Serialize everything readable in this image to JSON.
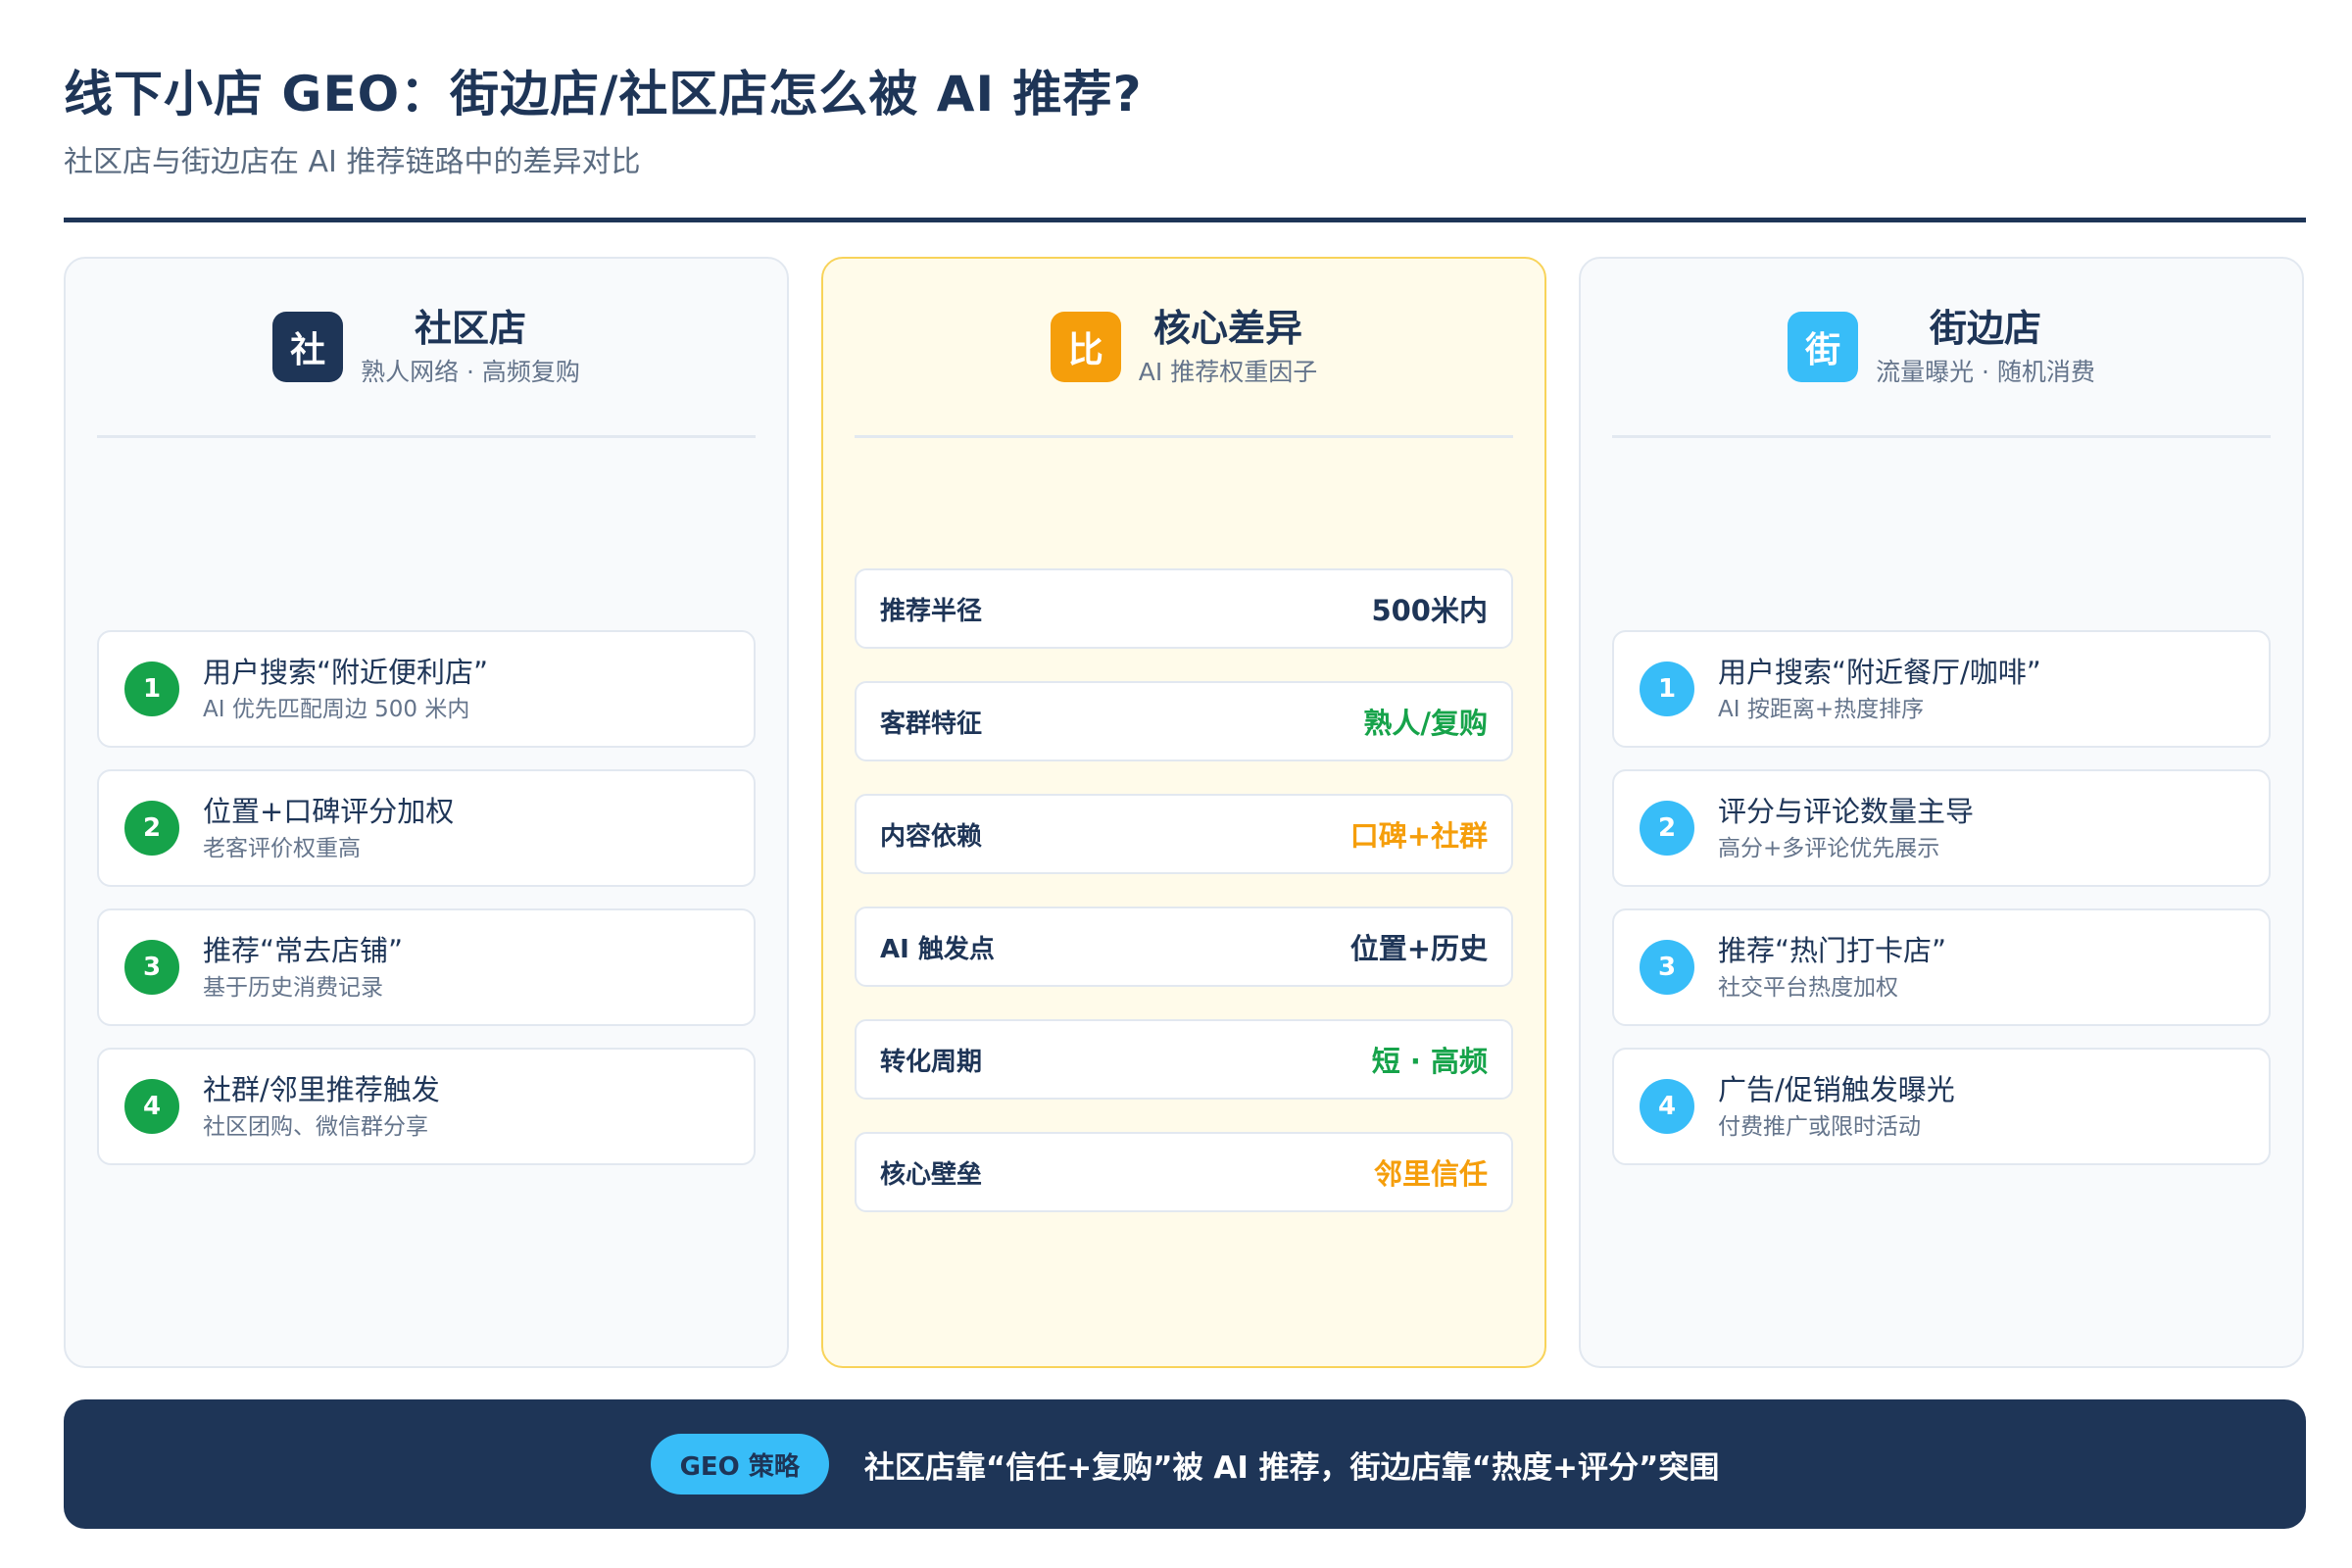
{
  "header": {
    "title": "线下小店 GEO：街边店/社区店怎么被 AI 推荐?",
    "subtitle": "社区店与街边店在 AI 推荐链路中的差异对比"
  },
  "community": {
    "badge": "社",
    "title": "社区店",
    "subtitle": "熟人网络 · 高频复购",
    "steps": [
      {
        "num": "1",
        "title": "用户搜索“附近便利店”",
        "desc": "AI 优先匹配周边 500 米内"
      },
      {
        "num": "2",
        "title": "位置+口碑评分加权",
        "desc": "老客评价权重高"
      },
      {
        "num": "3",
        "title": "推荐“常去店铺”",
        "desc": "基于历史消费记录"
      },
      {
        "num": "4",
        "title": "社群/邻里推荐触发",
        "desc": "社区团购、微信群分享"
      }
    ]
  },
  "core": {
    "badge": "比",
    "title": "核心差异",
    "subtitle": "AI 推荐权重因子",
    "metrics": [
      {
        "label": "推荐半径",
        "value": "500米内",
        "color": "#1e3557"
      },
      {
        "label": "客群特征",
        "value": "熟人/复购",
        "color": "#16a34a"
      },
      {
        "label": "内容依赖",
        "value": "口碑+社群",
        "color": "#f59e0b"
      },
      {
        "label": "AI 触发点",
        "value": "位置+历史",
        "color": "#1e3557"
      },
      {
        "label": "转化周期",
        "value": "短 · 高频",
        "color": "#16a34a"
      },
      {
        "label": "核心壁垒",
        "value": "邻里信任",
        "color": "#f59e0b"
      }
    ]
  },
  "street": {
    "badge": "街",
    "title": "街边店",
    "subtitle": "流量曝光 · 随机消费",
    "steps": [
      {
        "num": "1",
        "title": "用户搜索“附近餐厅/咖啡”",
        "desc": "AI 按距离+热度排序"
      },
      {
        "num": "2",
        "title": "评分与评论数量主导",
        "desc": "高分+多评论优先展示"
      },
      {
        "num": "3",
        "title": "推荐“热门打卡店”",
        "desc": "社交平台热度加权"
      },
      {
        "num": "4",
        "title": "广告/促销触发曝光",
        "desc": "付费推广或限时活动"
      }
    ]
  },
  "footer": {
    "pill": "GEO 策略",
    "text": "社区店靠“信任+复购”被 AI 推荐，街边店靠“热度+评分”突围"
  }
}
